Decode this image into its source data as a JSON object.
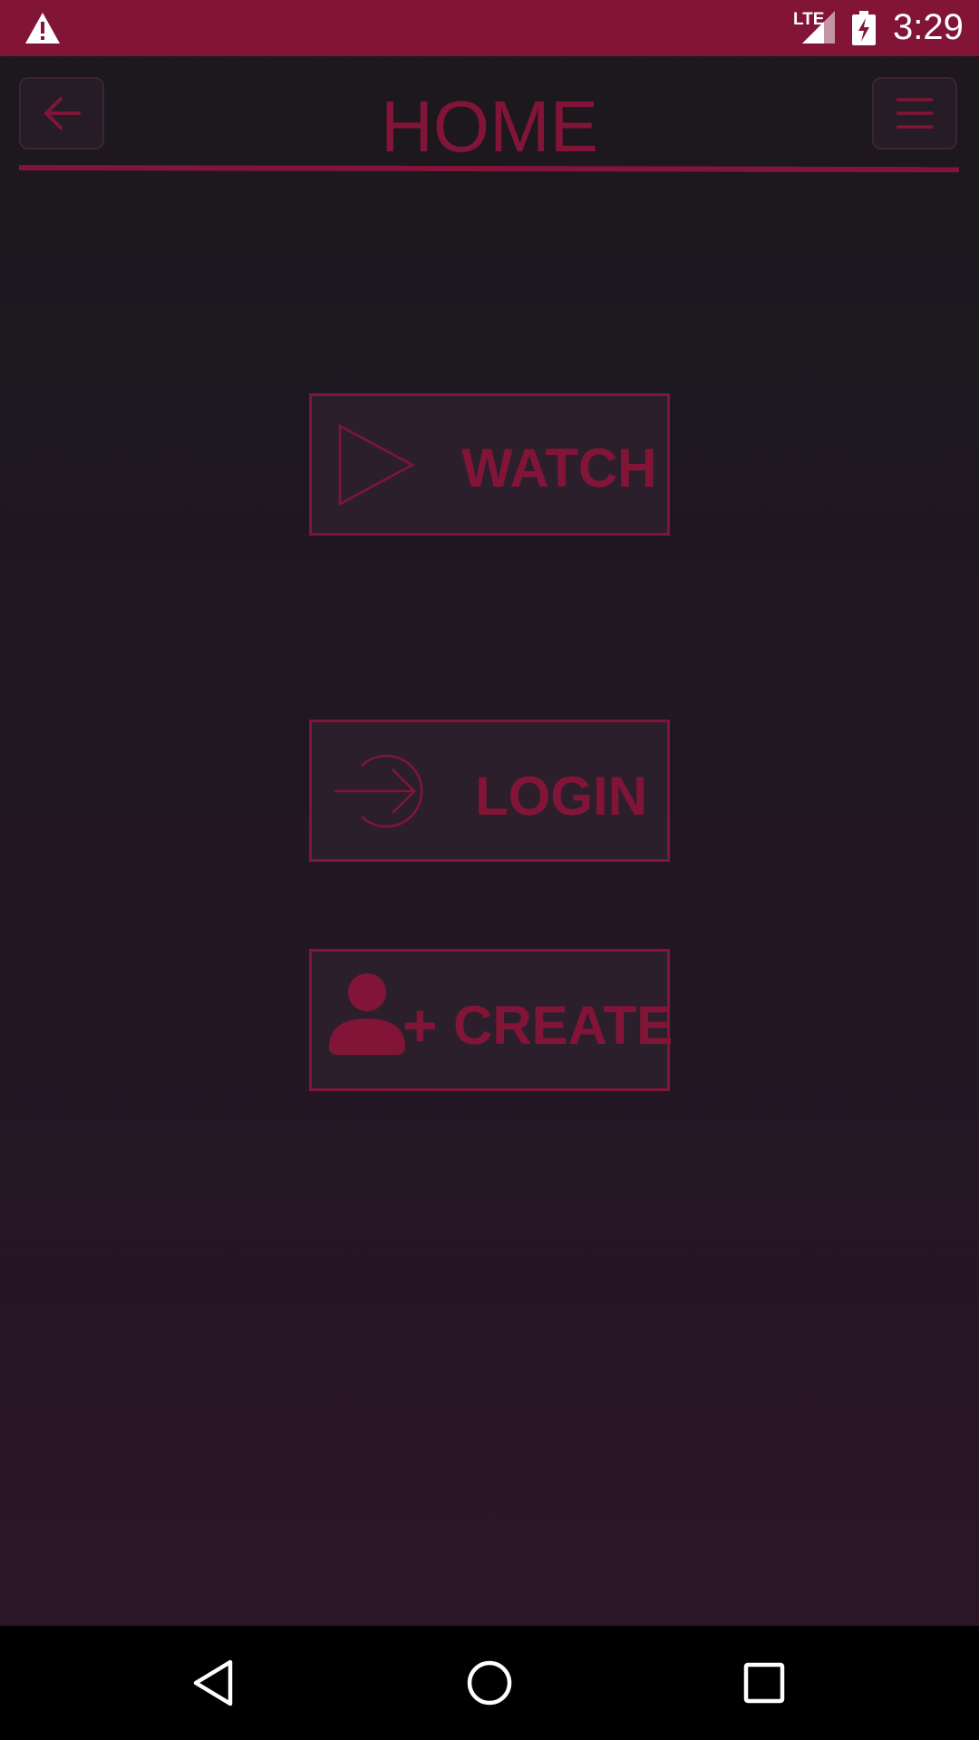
{
  "status_bar": {
    "network_label": "LTE",
    "time": "3:29",
    "icons": [
      "alert-icon",
      "signal-icon",
      "battery-charging-icon"
    ],
    "background_color": "#821537"
  },
  "header": {
    "title": "HOME",
    "back_icon": "arrow-left-icon",
    "menu_icon": "hamburger-menu-icon"
  },
  "actions": [
    {
      "label": "WATCH",
      "icon": "play-icon"
    },
    {
      "label": "LOGIN",
      "icon": "login-icon"
    },
    {
      "label": "CREATE",
      "icon": "add-user-icon",
      "prefix": "+"
    }
  ],
  "navigation_bar": {
    "icons": [
      "nav-back-icon",
      "nav-home-icon",
      "nav-recents-icon"
    ]
  },
  "colors": {
    "accent": "#821537",
    "background_top": "#1b181d",
    "background_bottom": "#2b1628",
    "button_fill": "#2b1f2c"
  }
}
